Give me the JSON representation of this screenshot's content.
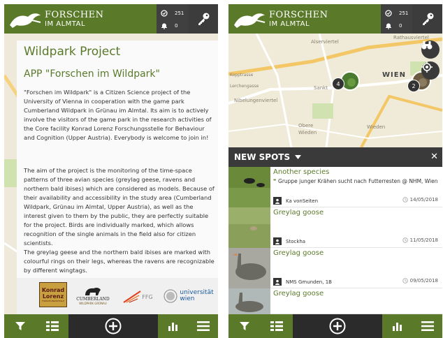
{
  "header": {
    "brand_line1": "FORSCHEN",
    "brand_line2": "IM ALMTAL",
    "spots_count": "251",
    "notifications_count": "0"
  },
  "info": {
    "title": "Wildpark Project",
    "subtitle": "APP \"Forschen im Wildpark\"",
    "paragraph1": "\"Forschen im Wildpark\" is a Citizen Science project of the University of Vienna in cooperation with the game park Cumberland Wildpark in Grünau im Almtal. Its aim is to actively involve the visitors of the game park in the research activities of the Core facility Konrad Lorenz Forschungsstelle for Behaviour and Cognition (Upper Austria). Everybody is welcome to join in!",
    "paragraph2": "The aim of the project is the monitoring of the time-space patterns of three avian species (greylag geese, ravens and northern bald ibises) which are considered as models. Because of their availability and accessibility in the study area (Cumberland Wildpark, Grünau im Almtal, Upper Austria), as well as the interest given to them by the public, they are perfectly suitable for the project. Birds are individually marked, which allows recognition of the single animals in the field also for citizen scientists.\nThe greylag geese and the northern bald ibises are marked with colourful rings on their legs, whereas the ravens are recognizable by different wingtags.",
    "logos": {
      "klf_line1": "Konrad",
      "klf_line2": "Lorenz",
      "klf_line3": "FORSCHUNGSSTELLE",
      "cumberland_line1": "CUMBERLAND",
      "cumberland_line2": "WILDPARK GRÜNAU",
      "ffg": "FFG",
      "uni_line1": "universität",
      "uni_line2": "wien"
    }
  },
  "map": {
    "labels": [
      "Alserviertel",
      "Kopptrasse",
      "Lerchengasse",
      "Nibelungenviertel",
      "Sankt",
      "WIEN",
      "Obere",
      "Wieden",
      "Wieden",
      "Rathausviertel"
    ],
    "cluster_1": "4",
    "cluster_2": "2"
  },
  "spots": {
    "header": "NEW SPOTS",
    "items": [
      {
        "title": "Another species",
        "quote": "Gruppe junger Krähen sucht nach Futterresten @ NHM, Wien",
        "user": "Ka vonSeiten",
        "date": "14/05/2018"
      },
      {
        "title": "Greylag goose",
        "quote": "",
        "user": "Stockha",
        "date": "11/05/2018"
      },
      {
        "title": "Greylag goose",
        "quote": "",
        "user": "NMS Gmunden, 1B",
        "date": "09/05/2018"
      },
      {
        "title": "Greylag goose",
        "quote": "",
        "user": "",
        "date": ""
      }
    ]
  },
  "colors": {
    "brand_green": "#5a7a2a",
    "dark": "#333333"
  },
  "icons": [
    "bird-logo-icon",
    "check-circle-icon",
    "bell-icon",
    "key-icon",
    "filter-icon",
    "list-icon",
    "add-circle-icon",
    "bar-chart-icon",
    "menu-icon",
    "binoculars-icon",
    "locate-icon",
    "user-icon",
    "clock-icon",
    "close-icon",
    "caret-down-icon",
    "quote-icon"
  ]
}
